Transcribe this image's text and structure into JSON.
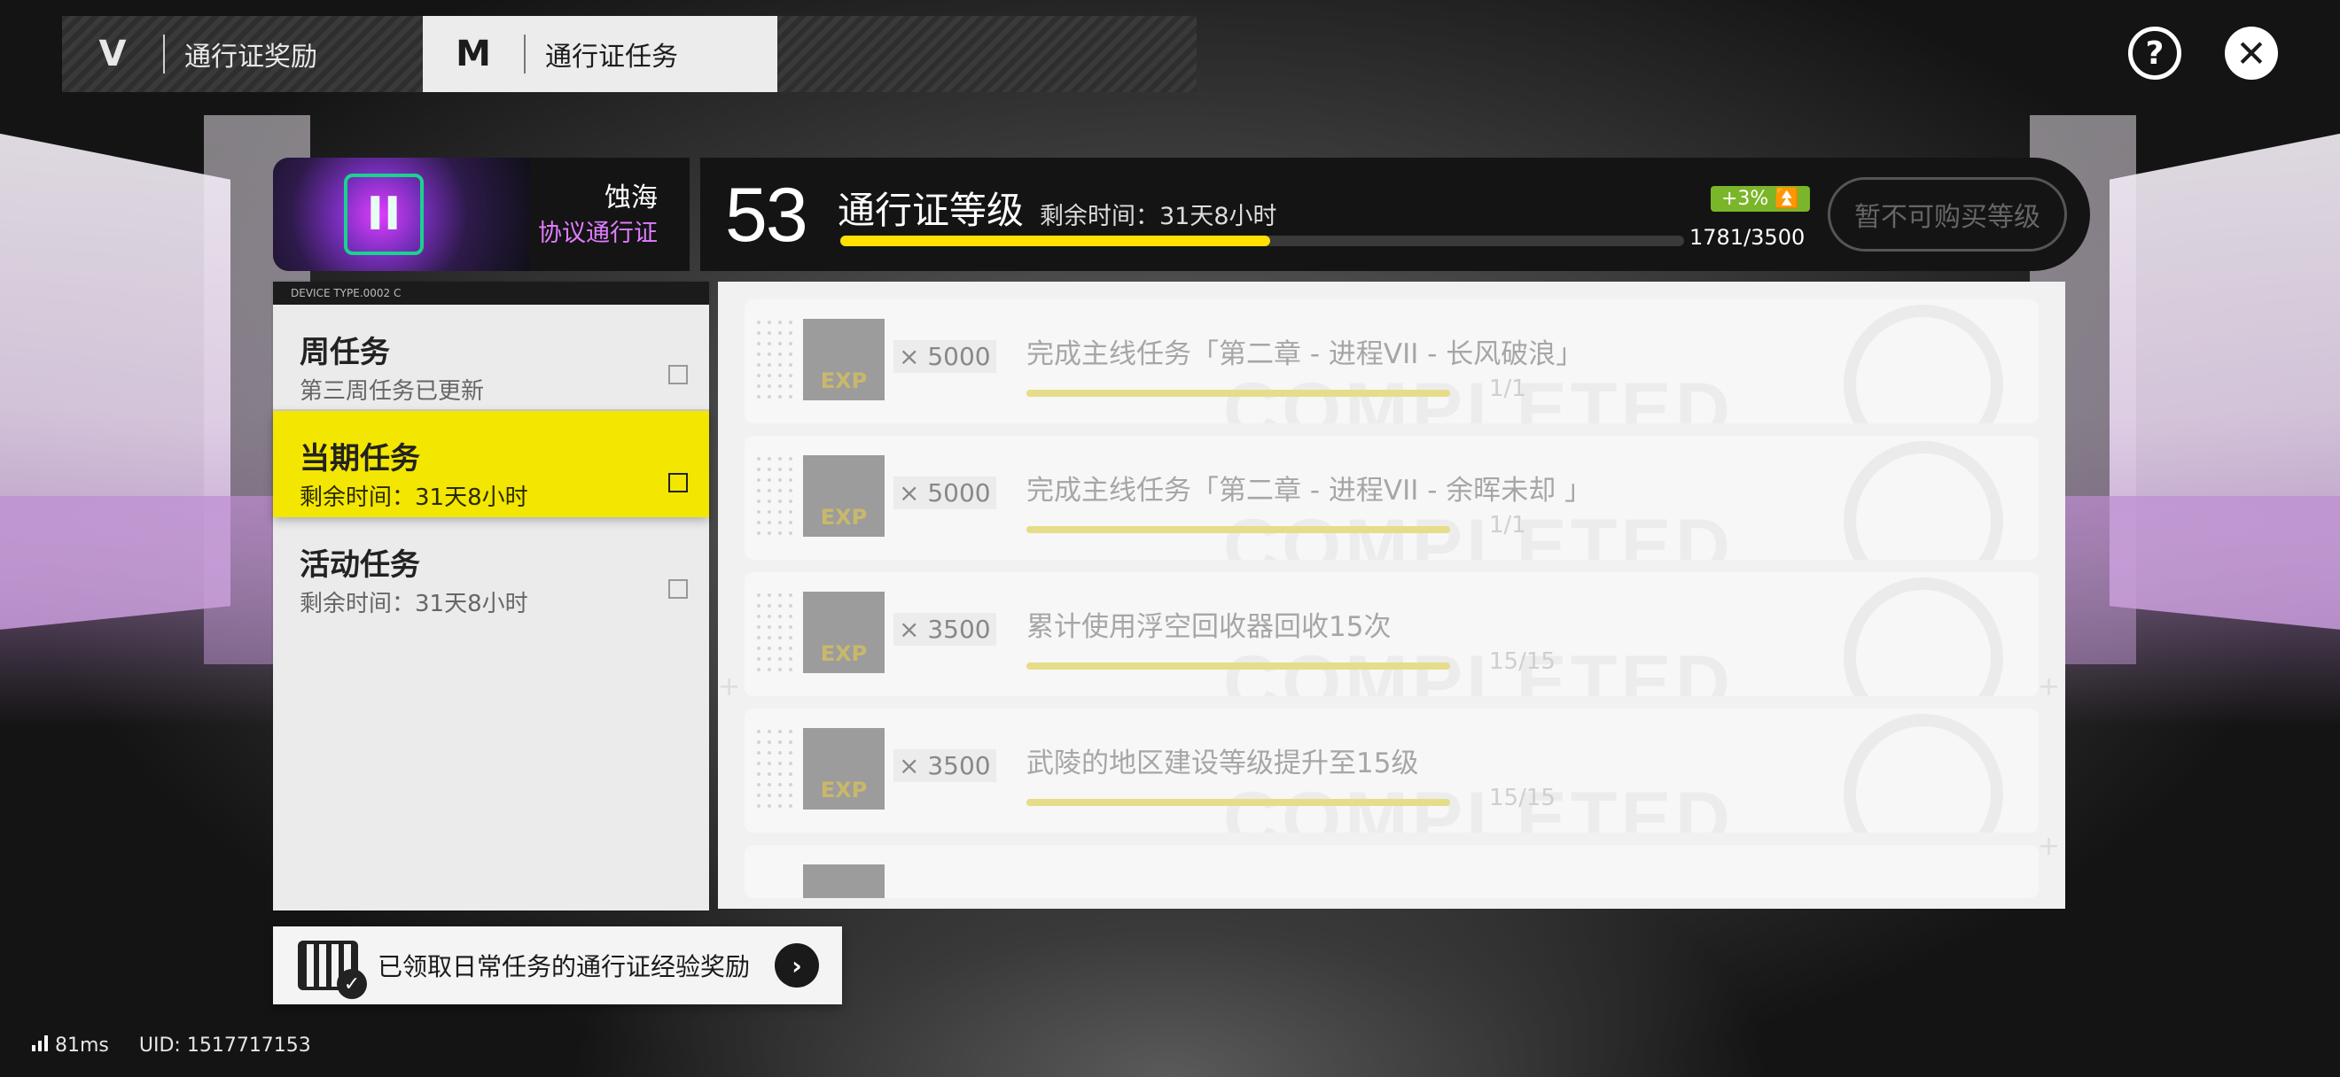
{
  "tabs": [
    {
      "label": "通行证奖励",
      "active": false
    },
    {
      "label": "通行证任务",
      "active": true
    }
  ],
  "header_icons": {
    "help": "?",
    "close": "✕"
  },
  "pass": {
    "name": "蚀海",
    "subtitle": "协议通行证"
  },
  "level": {
    "number": "53",
    "title": "通行证等级",
    "remaining_time": "剩余时间：31天8小时",
    "bonus": "+3%",
    "progress_text": "1781/3500",
    "progress_fraction": 0.509,
    "buy_button": "暂不可购买等级"
  },
  "categories_header": "DEVICE TYPE.0002 C",
  "categories": [
    {
      "name": "周任务",
      "sub": "第三周任务已更新"
    },
    {
      "name": "当期任务",
      "sub": "剩余时间：31天8小时"
    },
    {
      "name": "活动任务",
      "sub": "剩余时间：31天8小时"
    }
  ],
  "tasks": [
    {
      "reward_icon": "EXP",
      "qty": "× 5000",
      "title": "完成主线任务「第二章 - 进程VII - 长风破浪」",
      "count": "1/1",
      "progress_fraction": 1,
      "stamp": "COMPLETED"
    },
    {
      "reward_icon": "EXP",
      "qty": "× 5000",
      "title": "完成主线任务「第二章 - 进程VII - 余晖未却 」",
      "count": "1/1",
      "progress_fraction": 1,
      "stamp": "COMPLETED"
    },
    {
      "reward_icon": "EXP",
      "qty": "× 3500",
      "title": "累计使用浮空回收器回收15次",
      "count": "15/15",
      "progress_fraction": 1,
      "stamp": "COMPLETED"
    },
    {
      "reward_icon": "EXP",
      "qty": "× 3500",
      "title": "武陵的地区建设等级提升至15级",
      "count": "15/15",
      "progress_fraction": 1,
      "stamp": "COMPLETED"
    }
  ],
  "daily_button": {
    "label": "已领取日常任务的通行证经验奖励"
  },
  "status": {
    "ping": "81ms",
    "uid": "UID: 1517717153"
  },
  "colors": {
    "accent": "#f3e600",
    "bar_fill": "#ffe000",
    "bonus": "#7bb529",
    "pass_sub": "#e17cff"
  }
}
